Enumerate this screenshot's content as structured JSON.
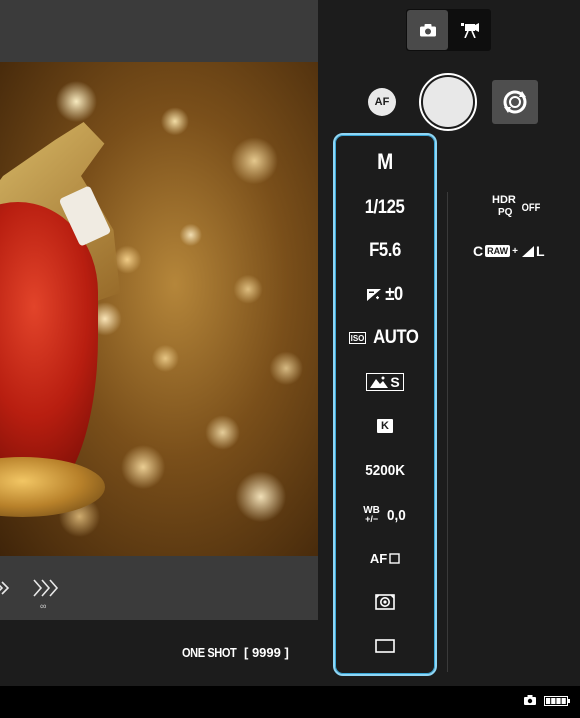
{
  "mode_toggle": {
    "photo_icon": "camera-icon",
    "video_icon": "movie-camera-icon"
  },
  "controls": {
    "af_label": "AF",
    "shutter_icon": "shutter-button",
    "switch_icon": "rotate-switch-icon"
  },
  "settings": {
    "shooting_mode": "M",
    "shutter_speed": "1/125",
    "aperture": "F5.6",
    "exposure_comp": "±0",
    "iso": "AUTO",
    "picture_style_suffix": "S",
    "wb_mode_label": "K",
    "color_temperature": "5200K",
    "wb_shift_label_top": "WB",
    "wb_shift_label_bottom": "+/−",
    "wb_shift": "0,0",
    "af_method": "AF",
    "metering_icon": "evaluative-metering-icon",
    "drive_icon": "single-shot-drive-icon"
  },
  "hdr": {
    "label": "HDR",
    "sub": "PQ",
    "state": "OFF"
  },
  "image_quality": {
    "compression": "C",
    "raw_label": "RAW",
    "plus": "+",
    "jpeg_size": "L"
  },
  "preview": {
    "focus_shift_label": "∞"
  },
  "status": {
    "af_operation": "ONE SHOT",
    "shots_remaining": "[ 9999 ]"
  },
  "colors": {
    "accent": "#8fd6f5",
    "panel_bg": "#1c1c1c",
    "preview_bg": "#3b3b3b"
  }
}
